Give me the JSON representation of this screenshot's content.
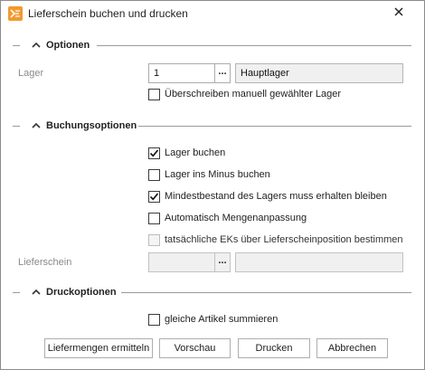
{
  "window": {
    "title": "Lieferschein buchen und drucken",
    "accent_color": "#f29a2e"
  },
  "sections": {
    "optionen": "Optionen",
    "buchungsoptionen": "Buchungsoptionen",
    "druckoptionen": "Druckoptionen"
  },
  "lager": {
    "label": "Lager",
    "value": "1",
    "browse_label": "...",
    "name": "Hauptlager"
  },
  "checkboxes": {
    "ueberschreiben": {
      "label": "Überschreiben manuell gewählter Lager",
      "checked": false
    },
    "lager_buchen": {
      "label": "Lager buchen",
      "checked": true
    },
    "lager_minus": {
      "label": "Lager ins Minus buchen",
      "checked": false
    },
    "mindestbestand": {
      "label": "Mindestbestand des Lagers muss erhalten bleiben",
      "checked": true
    },
    "mengenanpassung": {
      "label": "Automatisch Mengenanpassung",
      "checked": false
    },
    "eks": {
      "label": "tatsächliche EKs über Lieferscheinposition bestimmen",
      "checked": false,
      "disabled": true
    },
    "gleiche_artikel": {
      "label": "gleiche Artikel summieren",
      "checked": false
    }
  },
  "lieferschein": {
    "label": "Lieferschein",
    "value": "",
    "browse_label": "...",
    "name": ""
  },
  "buttons": {
    "liefermengen": "Liefermengen ermitteln",
    "vorschau": "Vorschau",
    "drucken": "Drucken",
    "abbrechen": "Abbrechen"
  }
}
